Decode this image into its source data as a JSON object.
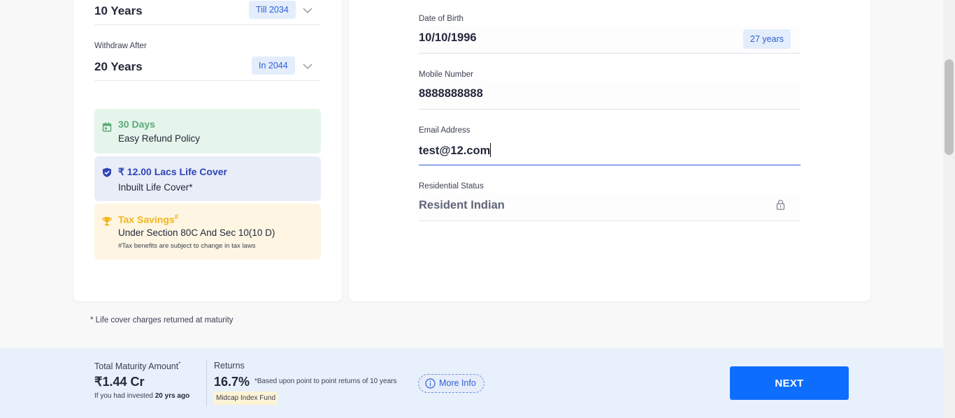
{
  "plan": {
    "pay_for": {
      "value": "10 Years",
      "badge": "Till 2034"
    },
    "withdraw": {
      "label": "Withdraw After",
      "value": "20 Years",
      "badge": "In 2044"
    }
  },
  "benefits": {
    "refund": {
      "title": "30 Days",
      "subtitle": "Easy Refund Policy",
      "icon": "calendar-icon",
      "color": "#5aaa79",
      "bg": "#e5f5eb"
    },
    "life_cover": {
      "title": "₹ 12.00 Lacs Life Cover",
      "subtitle": "Inbuilt Life Cover*",
      "icon": "shield-check-icon",
      "color": "#2f43b7",
      "bg": "#e9edf8"
    },
    "tax": {
      "title": "Tax Savings",
      "title_mark": "#",
      "subtitle": "Under Section 80C And Sec 10(10 D)",
      "note": "#Tax benefits are subject to change in tax laws",
      "icon": "trophy-icon",
      "color": "#f2b61d",
      "bg": "#fef6e2"
    }
  },
  "form": {
    "dob": {
      "label": "Date of Birth",
      "value": "10/10/1996",
      "age": "27 years"
    },
    "mobile": {
      "label": "Mobile Number",
      "value": "8888888888"
    },
    "email": {
      "label": "Email Address",
      "value": "test@12.com"
    },
    "residential": {
      "label": "Residential Status",
      "value": "Resident Indian",
      "icon": "lock-icon"
    }
  },
  "footnote": "* Life cover charges returned at maturity",
  "summary": {
    "maturity_label": "Total Maturity Amount",
    "maturity_mark": "*",
    "maturity_value": "₹1.44 Cr",
    "invested_prefix": "If you had invested",
    "invested_period": "20 yrs ago",
    "returns_label": "Returns",
    "returns_value": "16.7%",
    "returns_note": "*Based upon point to point returns of 10 years",
    "fund_name": "Midcap Index Fund",
    "more_info": "More Info",
    "next": "NEXT"
  },
  "colors": {
    "accent": "#0d6efd",
    "badge_bg": "#e4edfb",
    "badge_text": "#2c5fd6",
    "bar_bg": "#e8f0fb"
  }
}
